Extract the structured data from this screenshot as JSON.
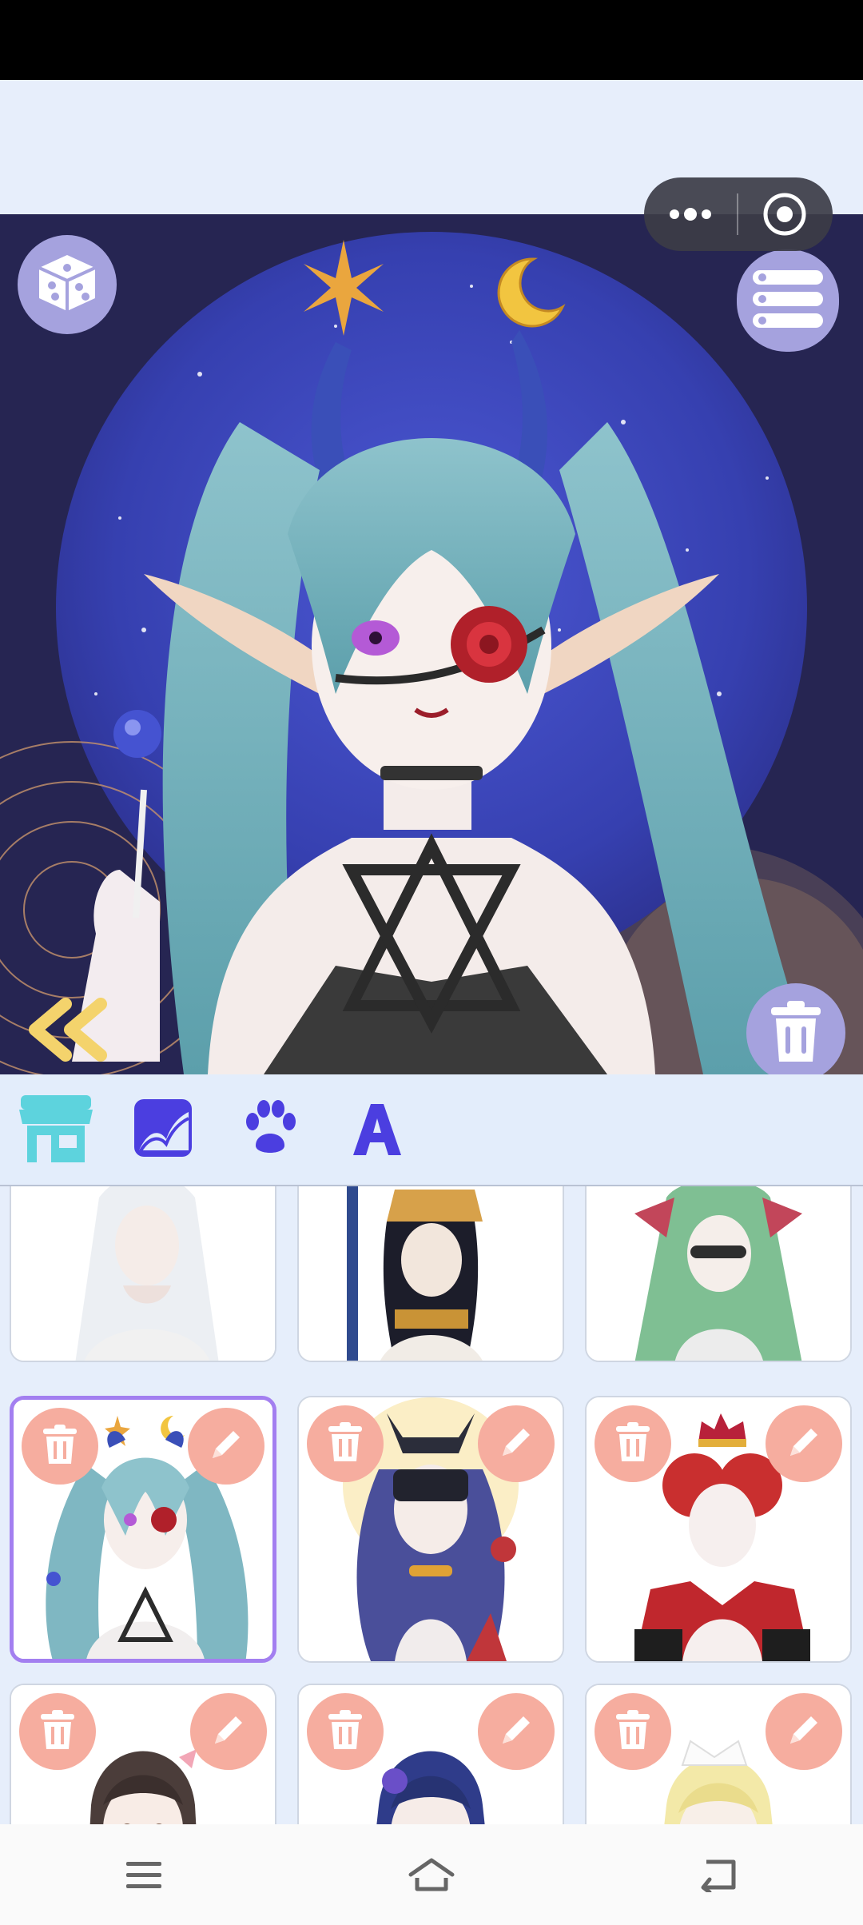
{
  "app": {
    "accent": "#a5a2de",
    "toolbar_active": "#5dd3dd",
    "toolbar_icon": "#4b3ee0",
    "card_action_color": "#f6ad9f"
  },
  "status_bar": {},
  "mini_program_capsule": {
    "more_icon": "more-dots-icon",
    "close_icon": "target-close-icon"
  },
  "preview": {
    "left_button_icon": "dice-icon",
    "right_button_icon": "list-menu-icon",
    "back_icon": "double-chevron-left-icon",
    "delete_icon": "trash-icon"
  },
  "toolbar": {
    "items": [
      {
        "icon": "shop-icon",
        "active": true
      },
      {
        "icon": "background-image-icon",
        "active": false
      },
      {
        "icon": "paw-icon",
        "active": false
      },
      {
        "icon": "letter-a-icon",
        "active": false
      }
    ]
  },
  "gallery": {
    "rows": [
      [
        {
          "theme": "bride-veil"
        },
        {
          "theme": "egyptian"
        },
        {
          "theme": "bat-wing"
        }
      ],
      [
        {
          "theme": "demon-elf",
          "selected": true
        },
        {
          "theme": "anubis"
        },
        {
          "theme": "red-queen"
        }
      ],
      [
        {
          "theme": "brunette"
        },
        {
          "theme": "navy-hair"
        },
        {
          "theme": "blonde-bow"
        }
      ]
    ],
    "delete_icon": "trash-icon",
    "edit_icon": "pencil-icon"
  },
  "nav_bar": {
    "icons": [
      "menu-icon",
      "home-icon",
      "back-icon"
    ]
  }
}
